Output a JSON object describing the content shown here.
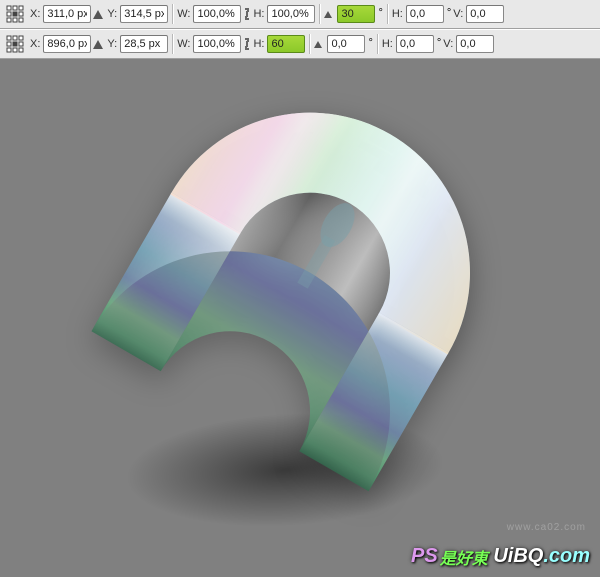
{
  "toolbars": [
    {
      "x_label": "X:",
      "x_value": "311,0 px",
      "y_label": "Y:",
      "y_value": "314,5 px",
      "w_label": "W:",
      "w_value": "100,0%",
      "h_label": "H:",
      "h_value": "100,0%",
      "rot_value": "30",
      "sh_label": "H:",
      "sh_value": "0,0",
      "sv_label": "V:",
      "sv_value": "0,0",
      "highlight": "rot"
    },
    {
      "x_label": "X:",
      "x_value": "896,0 px",
      "y_label": "Y:",
      "y_value": "28,5 px",
      "w_label": "W:",
      "w_value": "100,0%",
      "h_label": "H:",
      "h_value": "60",
      "rot_value": "0,0",
      "sh_label": "H:",
      "sh_value": "0,0",
      "sv_label": "V:",
      "sv_value": "0,0",
      "highlight": "h"
    }
  ],
  "watermark": {
    "ps": "PS",
    "cn": "是好東",
    "main": "UiBQ",
    "suffix": ".com",
    "sub": "www.ca02.com"
  }
}
